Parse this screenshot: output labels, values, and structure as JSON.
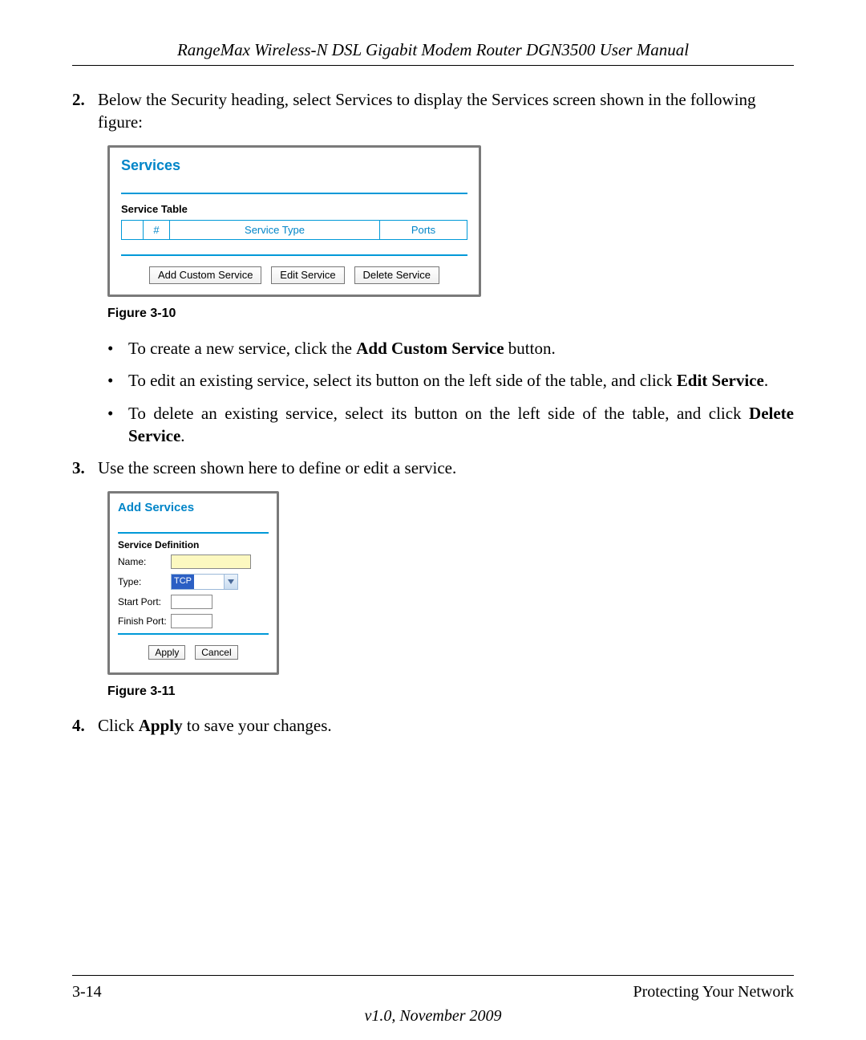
{
  "header": "RangeMax Wireless-N DSL Gigabit Modem Router DGN3500 User Manual",
  "step2": {
    "num": "2.",
    "text": "Below the Security heading, select Services to display the Services screen shown in the following figure:"
  },
  "fig310": {
    "title": "Services",
    "subtitle": "Service Table",
    "cols": {
      "num": "#",
      "type": "Service Type",
      "ports": "Ports"
    },
    "buttons": {
      "add": "Add Custom Service",
      "edit": "Edit Service",
      "del": "Delete Service"
    },
    "caption": "Figure 3-10"
  },
  "bullets": {
    "b1a": "To create a new service, click the ",
    "b1b": "Add Custom Service",
    "b1c": " button.",
    "b2a": "To edit an existing service, select its button on the left side of the table, and click ",
    "b2b": "Edit Service",
    "b2c": ".",
    "b3a": "To delete an existing service, select its button on the left side of the table, and click ",
    "b3b": "Delete Service",
    "b3c": "."
  },
  "step3": {
    "num": "3.",
    "text": "Use the screen shown here to define or edit a service."
  },
  "fig311": {
    "title": "Add Services",
    "subtitle": "Service Definition",
    "labels": {
      "name": "Name:",
      "type": "Type:",
      "start": "Start Port:",
      "finish": "Finish Port:"
    },
    "type_value": "TCP",
    "buttons": {
      "apply": "Apply",
      "cancel": "Cancel"
    },
    "caption": "Figure 3-11"
  },
  "step4": {
    "num": "4.",
    "a": "Click ",
    "b": "Apply",
    "c": " to save your changes."
  },
  "footer": {
    "page": "3-14",
    "section": "Protecting Your Network",
    "version": "v1.0, November 2009"
  }
}
